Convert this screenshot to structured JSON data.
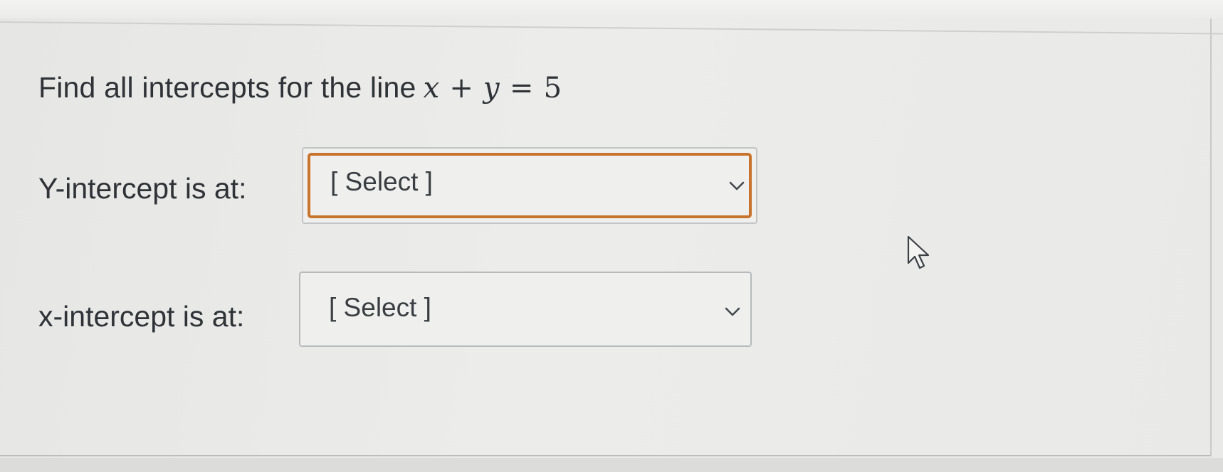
{
  "question": {
    "prompt_text": "Find all intercepts for the line",
    "equation": {
      "lhs_var1": "x",
      "plus": "+",
      "lhs_var2": "y",
      "equals": "=",
      "rhs": "5"
    }
  },
  "fields": [
    {
      "label": "Y-intercept is at:",
      "selected_value": "[ Select ]",
      "focused": true
    },
    {
      "label": "x-intercept is at:",
      "selected_value": "[ Select ]",
      "focused": false
    }
  ],
  "icons": {
    "dropdown": "chevron-down-icon",
    "pointer": "mouse-pointer-icon"
  },
  "colors": {
    "focus_ring": "#c8742c",
    "text": "#2f3237",
    "background": "#ebebe9"
  }
}
